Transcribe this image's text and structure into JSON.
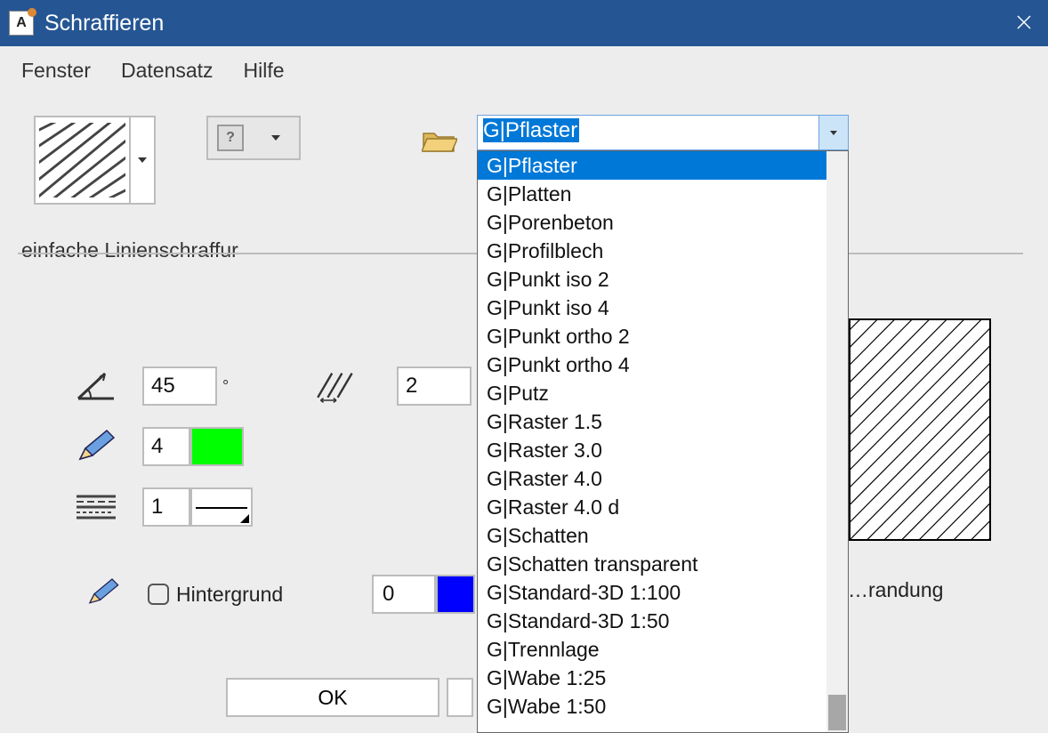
{
  "colors": {
    "accent": "#255693",
    "highlight": "#0078d7",
    "green": "#00ff00",
    "blue": "#0000ff"
  },
  "window": {
    "title": "Schraffieren"
  },
  "menubar": {
    "fenster": "Fenster",
    "datensatz": "Datensatz",
    "hilfe": "Hilfe"
  },
  "section": {
    "title": "einfache Linienschraffur"
  },
  "fields": {
    "angle": {
      "value": "45",
      "unit": "°"
    },
    "spacing": {
      "value": "2"
    },
    "pen": {
      "value": "4"
    },
    "linetype": {
      "value": "1"
    },
    "background_label": "Hintergrund",
    "background_pen": {
      "value": "0"
    }
  },
  "umrandung": "…randung",
  "combo": {
    "selected": "G|Pflaster",
    "options": [
      "G|Pflaster",
      "G|Platten",
      "G|Porenbeton",
      "G|Profilblech",
      "G|Punkt iso 2",
      "G|Punkt iso 4",
      "G|Punkt ortho 2",
      "G|Punkt ortho 4",
      "G|Putz",
      "G|Raster 1.5",
      "G|Raster 3.0",
      "G|Raster 4.0",
      "G|Raster 4.0 d",
      "G|Schatten",
      "G|Schatten transparent",
      "G|Standard-3D 1:100",
      "G|Standard-3D 1:50",
      "G|Trennlage",
      "G|Wabe 1:25",
      "G|Wabe 1:50"
    ]
  },
  "buttons": {
    "ok": "OK"
  }
}
